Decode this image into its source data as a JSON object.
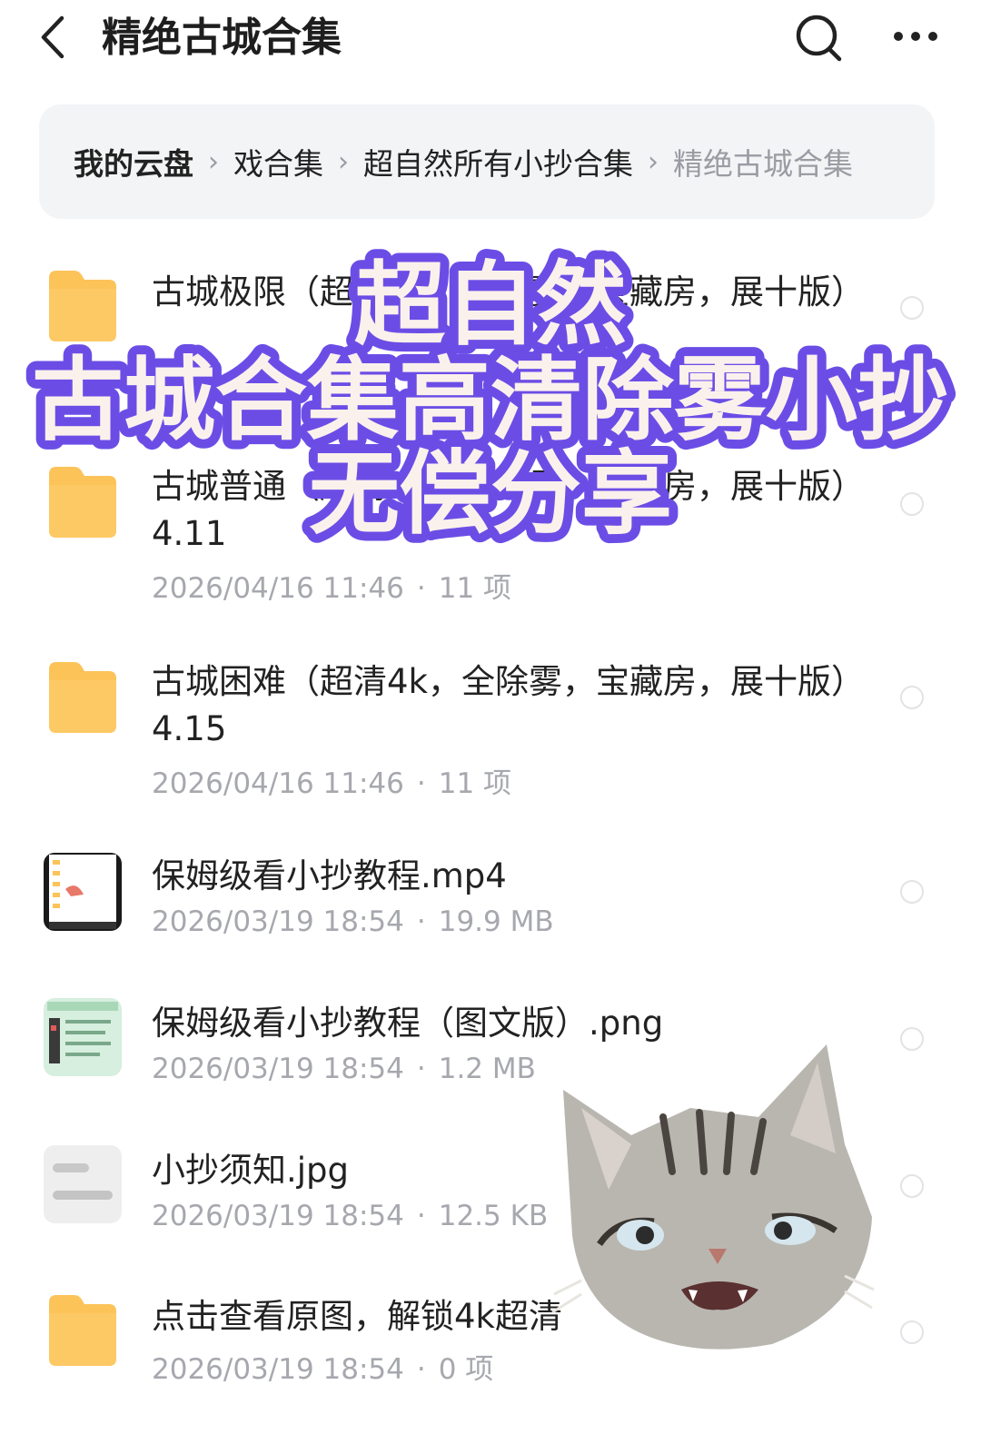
{
  "header": {
    "back_icon": "chevron-left-icon",
    "title": "精绝古城合集",
    "search_icon": "search-icon",
    "more_icon": "more-horizontal-icon"
  },
  "breadcrumb": {
    "items": [
      {
        "label": "我的云盘"
      },
      {
        "label": "戏合集"
      },
      {
        "label": "超自然所有小抄合集"
      },
      {
        "label": "精绝古城合集"
      }
    ],
    "separator": "›"
  },
  "files": [
    {
      "name": "古城极限（超清4k，全除雾，宝藏房，展十版）",
      "meta_date": "",
      "meta_info": "",
      "type": "folder"
    },
    {
      "name": "古城普通（超清4k，全除雾，宝藏房，展十版）4.11",
      "meta_date": "2026/04/16 11:46",
      "meta_info": "11 项",
      "type": "folder"
    },
    {
      "name": "古城困难（超清4k，全除雾，宝藏房，展十版）4.15",
      "meta_date": "2026/04/16 11:46",
      "meta_info": "11 项",
      "type": "folder"
    },
    {
      "name": "保姆级看小抄教程.mp4",
      "meta_date": "2026/03/19 18:54",
      "meta_info": "19.9 MB",
      "type": "video"
    },
    {
      "name": "保姆级看小抄教程（图文版）.png",
      "meta_date": "2026/03/19 18:54",
      "meta_info": "1.2 MB",
      "type": "image"
    },
    {
      "name": "小抄须知.jpg",
      "meta_date": "2026/03/19 18:54",
      "meta_info": "12.5 KB",
      "type": "image-blurred"
    },
    {
      "name": "点击查看原图，解锁4k超清",
      "meta_date": "2026/03/19 18:54",
      "meta_info": "0 项",
      "type": "folder"
    }
  ],
  "overlay": {
    "line1": "超自然",
    "line2": "古城合集高清除雾小抄",
    "line3": "无偿分享"
  },
  "colors": {
    "folder": "#fcc359",
    "overlay_fill": "#fbf1ec",
    "overlay_stroke": "#6b4de6"
  }
}
